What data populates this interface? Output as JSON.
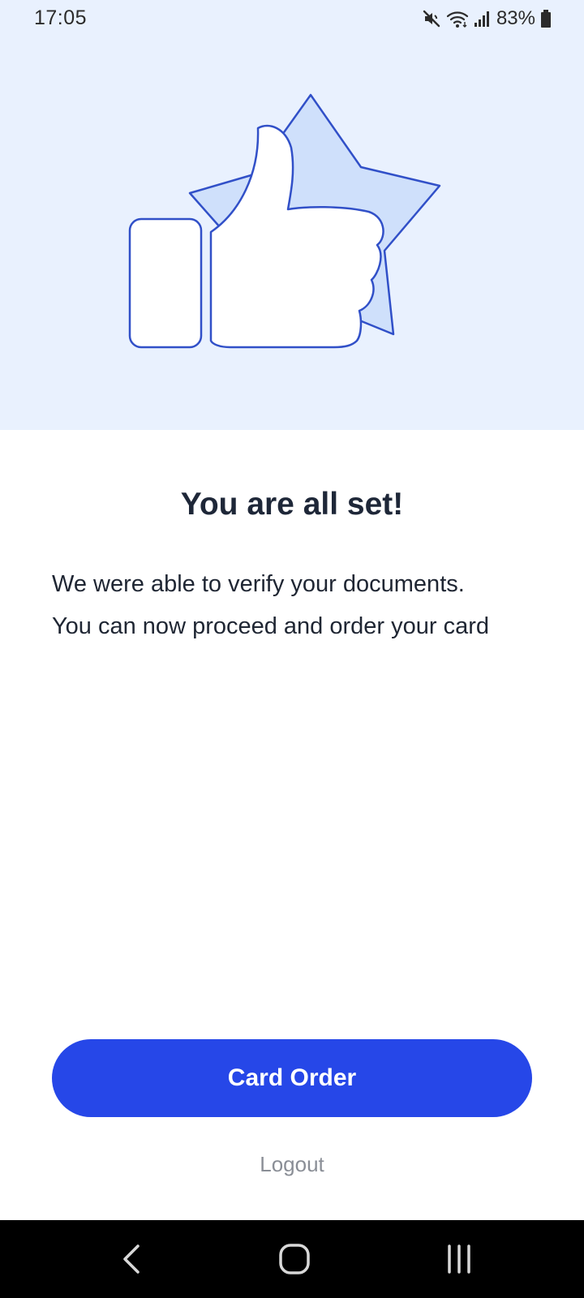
{
  "status_bar": {
    "time": "17:05",
    "battery": "83%",
    "icons": [
      "mute-icon",
      "wifi-icon",
      "signal-icon",
      "battery-icon"
    ]
  },
  "hero": {
    "illustration": "thumbs-up-star-illustration",
    "background_color": "#e9f1fe"
  },
  "content": {
    "title": "You are all set!",
    "line1": "We were able to verify your documents.",
    "line2": "You can now proceed and order your card"
  },
  "actions": {
    "primary_label": "Card Order",
    "secondary_label": "Logout",
    "accent_color": "#2647e8"
  },
  "nav_bar": {
    "icons": [
      "back-icon",
      "home-icon",
      "recents-icon"
    ]
  }
}
